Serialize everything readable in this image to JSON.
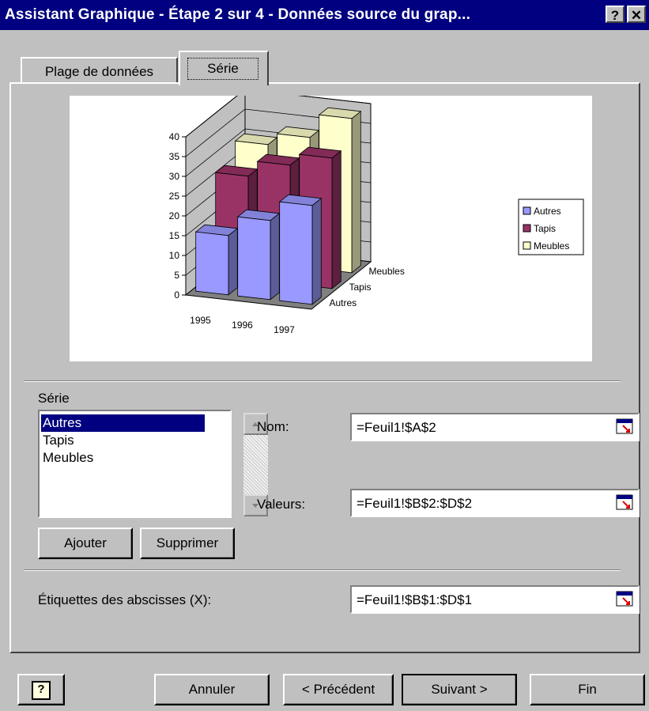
{
  "window": {
    "title": "Assistant Graphique - Étape 2 sur 4 - Données source du grap...",
    "help_glyph": "?",
    "close_glyph": "✕"
  },
  "tabs": [
    {
      "label": "Plage de données",
      "active": false
    },
    {
      "label": "Série",
      "active": true
    }
  ],
  "chart_data": {
    "type": "bar",
    "categories": [
      "1995",
      "1996",
      "1997"
    ],
    "series": [
      {
        "name": "Autres",
        "values": [
          15,
          20,
          25
        ],
        "color": "#9999ff"
      },
      {
        "name": "Tapis",
        "values": [
          26,
          30,
          33
        ],
        "color": "#993366"
      },
      {
        "name": "Meubles",
        "values": [
          30,
          33,
          39
        ],
        "color": "#ffffcc"
      }
    ],
    "ylim": [
      0,
      40
    ],
    "yticks": [
      "0",
      "5",
      "10",
      "15",
      "20",
      "25",
      "30",
      "35",
      "40"
    ],
    "depth_labels": [
      "Meubles",
      "Tapis",
      "Autres"
    ],
    "legend_position": "right",
    "grid": true,
    "title": "",
    "xlabel": "",
    "ylabel": ""
  },
  "series_section": {
    "label": "Série",
    "items": [
      "Autres",
      "Tapis",
      "Meubles"
    ],
    "selected": "Autres",
    "add_button": "Ajouter",
    "remove_button": "Supprimer"
  },
  "fields": {
    "name_label": "Nom:",
    "name_value": "=Feuil1!$A$2",
    "values_label": "Valeurs:",
    "values_value": "=Feuil1!$B$2:$D$2",
    "xlabels_label": "Étiquettes des abscisses (X):",
    "xlabels_value": "=Feuil1!$B$1:$D$1"
  },
  "footer": {
    "help_icon": "?",
    "cancel": "Annuler",
    "previous": "< Précédent",
    "next": "Suivant >",
    "finish": "Fin"
  }
}
